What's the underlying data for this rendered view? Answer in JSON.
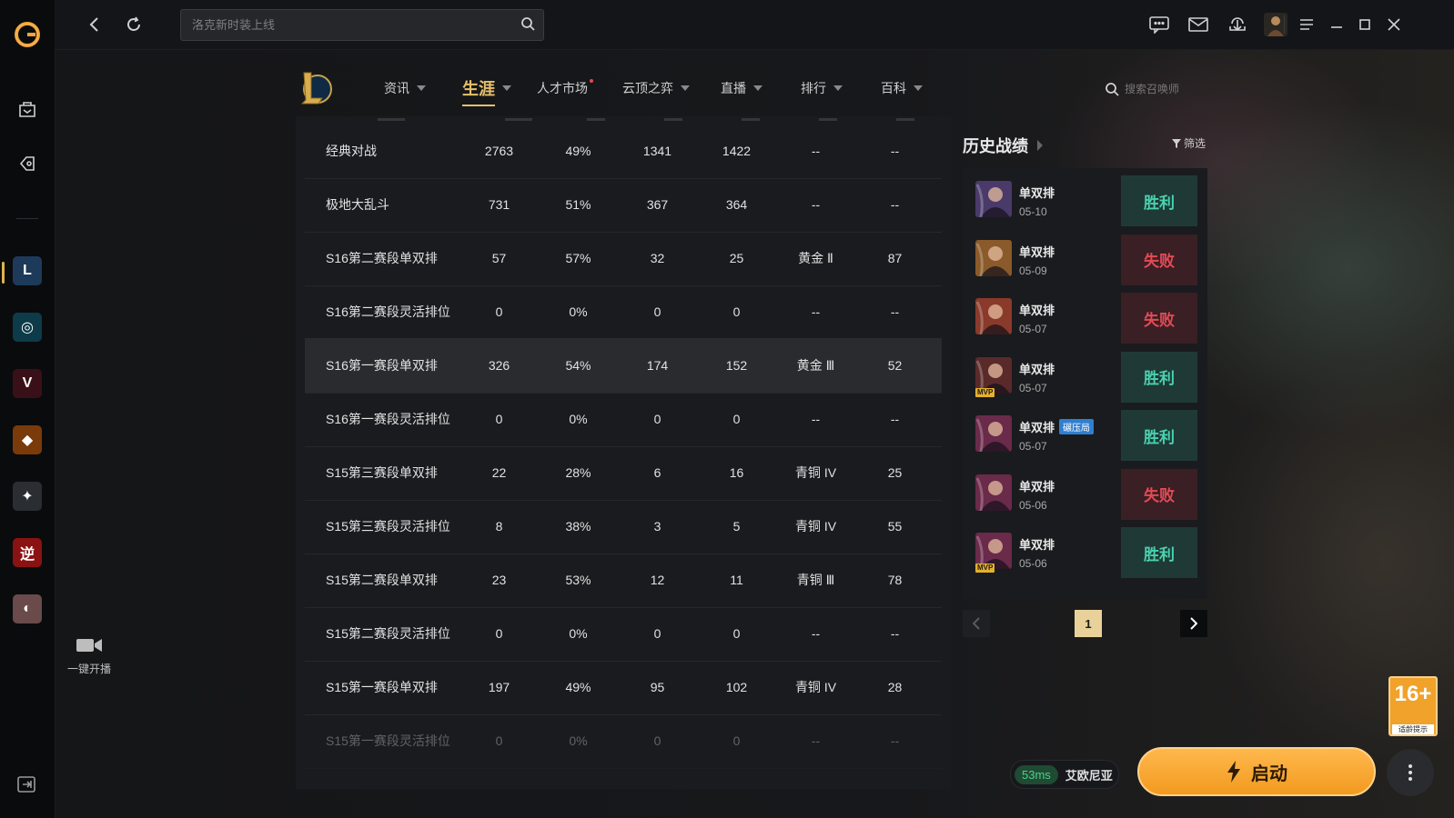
{
  "topbar": {
    "search_placeholder": "洛克新时装上线"
  },
  "nav": {
    "items": [
      {
        "label": "资讯",
        "has_dot": false
      },
      {
        "label": "生涯",
        "has_dot": false
      },
      {
        "label": "人才市场",
        "has_dot": true
      },
      {
        "label": "云顶之弈",
        "has_dot": false
      },
      {
        "label": "直播",
        "has_dot": false
      },
      {
        "label": "排行",
        "has_dot": false
      },
      {
        "label": "百科",
        "has_dot": false
      }
    ],
    "active_index": 1,
    "summoner_search_placeholder": "搜索召唤师"
  },
  "stats_table": {
    "rows": [
      {
        "mode": "经典对战",
        "games": "2763",
        "winrate": "49%",
        "wins": "1341",
        "losses": "1422",
        "rank": "--",
        "lp": "--"
      },
      {
        "mode": "极地大乱斗",
        "games": "731",
        "winrate": "51%",
        "wins": "367",
        "losses": "364",
        "rank": "--",
        "lp": "--"
      },
      {
        "mode": "S16第二赛段单双排",
        "games": "57",
        "winrate": "57%",
        "wins": "32",
        "losses": "25",
        "rank": "黄金 Ⅱ",
        "lp": "87"
      },
      {
        "mode": "S16第二赛段灵活排位",
        "games": "0",
        "winrate": "0%",
        "wins": "0",
        "losses": "0",
        "rank": "--",
        "lp": "--"
      },
      {
        "mode": "S16第一赛段单双排",
        "games": "326",
        "winrate": "54%",
        "wins": "174",
        "losses": "152",
        "rank": "黄金 Ⅲ",
        "lp": "52"
      },
      {
        "mode": "S16第一赛段灵活排位",
        "games": "0",
        "winrate": "0%",
        "wins": "0",
        "losses": "0",
        "rank": "--",
        "lp": "--"
      },
      {
        "mode": "S15第三赛段单双排",
        "games": "22",
        "winrate": "28%",
        "wins": "6",
        "losses": "16",
        "rank": "青铜 IV",
        "lp": "25"
      },
      {
        "mode": "S15第三赛段灵活排位",
        "games": "8",
        "winrate": "38%",
        "wins": "3",
        "losses": "5",
        "rank": "青铜 IV",
        "lp": "55"
      },
      {
        "mode": "S15第二赛段单双排",
        "games": "23",
        "winrate": "53%",
        "wins": "12",
        "losses": "11",
        "rank": "青铜 Ⅲ",
        "lp": "78"
      },
      {
        "mode": "S15第二赛段灵活排位",
        "games": "0",
        "winrate": "0%",
        "wins": "0",
        "losses": "0",
        "rank": "--",
        "lp": "--"
      },
      {
        "mode": "S15第一赛段单双排",
        "games": "197",
        "winrate": "49%",
        "wins": "95",
        "losses": "102",
        "rank": "青铜 IV",
        "lp": "28"
      },
      {
        "mode": "S15第一赛段灵活排位",
        "games": "0",
        "winrate": "0%",
        "wins": "0",
        "losses": "0",
        "rank": "--",
        "lp": "--"
      }
    ],
    "highlighted_row": 4
  },
  "history": {
    "title": "历史战绩",
    "filter_label": "筛选",
    "matches": [
      {
        "mode": "单双排",
        "date": "05-10",
        "result": "胜利",
        "win": true,
        "mvp": false,
        "tag": "",
        "champ_color": "#4a3a6a"
      },
      {
        "mode": "单双排",
        "date": "05-09",
        "result": "失败",
        "win": false,
        "mvp": false,
        "tag": "",
        "champ_color": "#8a5a2a"
      },
      {
        "mode": "单双排",
        "date": "05-07",
        "result": "失败",
        "win": false,
        "mvp": false,
        "tag": "",
        "champ_color": "#8a3a2a"
      },
      {
        "mode": "单双排",
        "date": "05-07",
        "result": "胜利",
        "win": true,
        "mvp": true,
        "tag": "",
        "champ_color": "#5a2a2a"
      },
      {
        "mode": "单双排",
        "date": "05-07",
        "result": "胜利",
        "win": true,
        "mvp": false,
        "tag": "碾压局",
        "champ_color": "#6a2a4a"
      },
      {
        "mode": "单双排",
        "date": "05-06",
        "result": "失败",
        "win": false,
        "mvp": false,
        "tag": "",
        "champ_color": "#6a2a4a"
      },
      {
        "mode": "单双排",
        "date": "05-06",
        "result": "胜利",
        "win": true,
        "mvp": true,
        "tag": "",
        "champ_color": "#6a2a4a"
      }
    ],
    "mvp_label": "MVP",
    "page": "1"
  },
  "sidebar": {
    "live_label": "一键开播",
    "games": [
      {
        "name": "lol",
        "color": "#1e3a5a",
        "glyph": "L"
      },
      {
        "name": "game-cyan",
        "color": "#0e3b4a",
        "glyph": "◎"
      },
      {
        "name": "valorant",
        "color": "#3a1018",
        "glyph": "V"
      },
      {
        "name": "game-orange",
        "color": "#7a3a0a",
        "glyph": "◆"
      },
      {
        "name": "game-cf",
        "color": "#2a2e33",
        "glyph": "✦"
      },
      {
        "name": "game-ni",
        "color": "#8a1212",
        "glyph": "逆"
      },
      {
        "name": "game-girl",
        "color": "#6a4a4a",
        "glyph": "◐"
      }
    ]
  },
  "age_rating": {
    "age": "16+",
    "label": "适龄提示"
  },
  "footer": {
    "ping": "53ms",
    "server": "艾欧尼亚",
    "launch_label": "启动"
  }
}
